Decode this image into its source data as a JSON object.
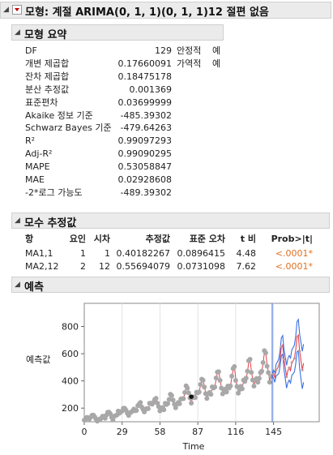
{
  "window": {
    "title": "모형: 계절 ARIMA(0, 1, 1)(0, 1, 1)12 절편 없음"
  },
  "summary": {
    "title": "모형 요약",
    "rows": [
      {
        "label": "DF",
        "value": "129"
      },
      {
        "label": "개변 제곱합",
        "value": "0.17660091"
      },
      {
        "label": "잔차 제곱합",
        "value": "0.18475178"
      },
      {
        "label": "분산 추정값",
        "value": "0.001369"
      },
      {
        "label": "표준편차",
        "value": "0.03699999"
      },
      {
        "label": "Akaike 정보 기준",
        "value": "-485.39302"
      },
      {
        "label": "Schwarz Bayes 기준",
        "value": "-479.64263"
      },
      {
        "label": "R²",
        "value": "0.99097293"
      },
      {
        "label": "Adj-R²",
        "value": "0.99090295"
      },
      {
        "label": "MAPE",
        "value": "0.53058847"
      },
      {
        "label": "MAE",
        "value": "0.02928608"
      },
      {
        "label": "-2*로그 가능도",
        "value": "-489.39302"
      }
    ],
    "side": [
      {
        "label": "안정적",
        "value": "예"
      },
      {
        "label": "가역적",
        "value": "예"
      }
    ]
  },
  "params": {
    "title": "모수 추정값",
    "headers": [
      "항",
      "요인",
      "시차",
      "추정값",
      "표준 오차",
      "t 비",
      "Prob>|t|"
    ],
    "rows": [
      [
        "MA1,1",
        "1",
        "1",
        "0.40182267",
        "0.0896415",
        "4.48",
        "<.0001*"
      ],
      [
        "MA2,12",
        "2",
        "12",
        "0.55694079",
        "0.0731098",
        "7.62",
        "<.0001*"
      ]
    ]
  },
  "forecast": {
    "title": "예측"
  },
  "chart_data": {
    "type": "line",
    "xlabel": "Time",
    "ylabel": "예측값",
    "xticks": [
      0,
      29,
      58,
      87,
      116,
      145
    ],
    "yticks": [
      200,
      400,
      600,
      800
    ],
    "xlim": [
      0,
      180
    ],
    "ylim": [
      100,
      970
    ],
    "actual": [
      112,
      118,
      132,
      129,
      121,
      135,
      148,
      148,
      136,
      119,
      104,
      118,
      115,
      126,
      141,
      135,
      125,
      149,
      170,
      170,
      158,
      133,
      114,
      140,
      145,
      150,
      178,
      163,
      172,
      178,
      199,
      199,
      184,
      162,
      146,
      166,
      171,
      180,
      193,
      181,
      183,
      218,
      230,
      242,
      209,
      191,
      172,
      194,
      196,
      196,
      236,
      235,
      229,
      243,
      264,
      272,
      237,
      211,
      180,
      201,
      204,
      188,
      235,
      227,
      234,
      264,
      302,
      293,
      259,
      229,
      203,
      229,
      242,
      233,
      267,
      269,
      270,
      315,
      364,
      347,
      312,
      274,
      237,
      278,
      284,
      277,
      317,
      313,
      318,
      374,
      413,
      405,
      355,
      306,
      271,
      306,
      315,
      301,
      356,
      348,
      355,
      422,
      465,
      467,
      404,
      347,
      305,
      336,
      340,
      318,
      362,
      348,
      363,
      435,
      491,
      505,
      404,
      359,
      310,
      337,
      360,
      342,
      406,
      396,
      420,
      472,
      548,
      559,
      463,
      407,
      362,
      405,
      417,
      391,
      419,
      461,
      472,
      535,
      622,
      606,
      508,
      461,
      390,
      432
    ],
    "highlighted_point": {
      "x": 82,
      "y": 284
    },
    "forecast_series": [
      {
        "name": "prediction",
        "color": "#e8404c",
        "start": 144,
        "values": [
          432,
          450,
          426,
          480,
          492,
          509,
          566,
          652,
          664,
          558,
          496,
          431,
          476,
          496,
          476,
          536,
          548,
          566,
          628,
          724,
          737,
          620,
          552,
          480,
          530
        ]
      },
      {
        "name": "upper",
        "color": "#3a6fe0",
        "start": 144,
        "values": [
          432,
          479,
          462,
          523,
          540,
          562,
          624,
          716,
          733,
          632,
          575,
          515,
          565,
          586,
          568,
          630,
          644,
          665,
          730,
          835,
          852,
          745,
          685,
          618,
          670
        ]
      },
      {
        "name": "lower",
        "color": "#3a6fe0",
        "start": 144,
        "values": [
          432,
          421,
          390,
          437,
          444,
          456,
          508,
          588,
          595,
          484,
          417,
          347,
          387,
          406,
          384,
          442,
          452,
          467,
          526,
          613,
          622,
          495,
          419,
          342,
          390
        ]
      }
    ],
    "fit_color": "#e8404c",
    "actual_color": "#a8a8a8",
    "divider_x": 144,
    "divider_color": "#2f5fd8"
  }
}
